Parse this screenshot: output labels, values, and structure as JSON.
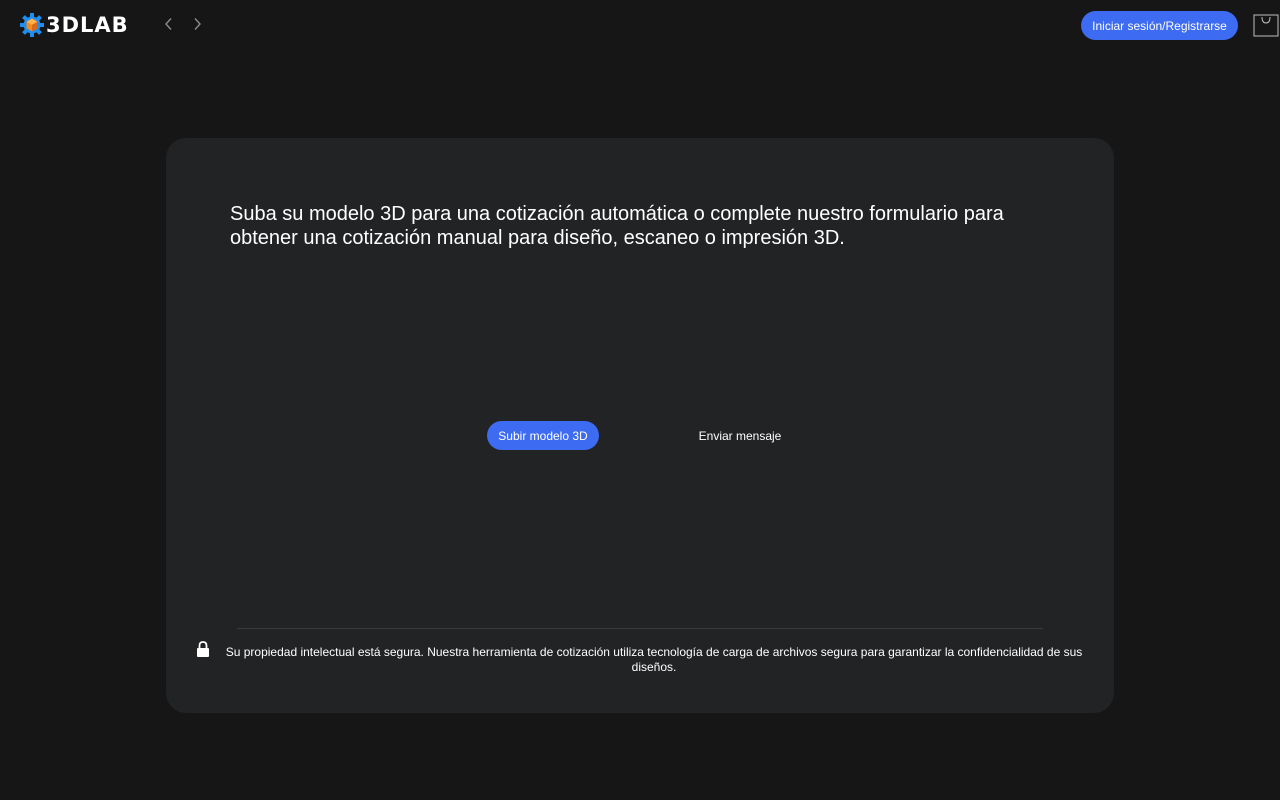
{
  "header": {
    "logo_text": "3DLAB",
    "back_icon": "chevron-left-icon",
    "forward_icon": "chevron-right-icon",
    "login_label": "Iniciar sesión/Registrarse",
    "cart_icon": "shopping-bag-icon"
  },
  "card": {
    "headline": "Suba su modelo 3D para una cotización automática o complete nuestro formulario para obtener una cotización manual para diseño, escaneo o impresión 3D.",
    "upload_label": "Subir modelo 3D",
    "message_label": "Enviar mensaje",
    "lock_icon": "lock-icon",
    "notice": "Su propiedad intelectual está segura. Nuestra herramienta de cotización utiliza tecnología de carga de archivos segura para garantizar la confidencialidad de sus diseños."
  },
  "colors": {
    "background": "#161617",
    "card": "#222325",
    "accent": "#3d6bf2",
    "logo_orange": "#f28a1e",
    "logo_blue": "#1f8ef1"
  }
}
